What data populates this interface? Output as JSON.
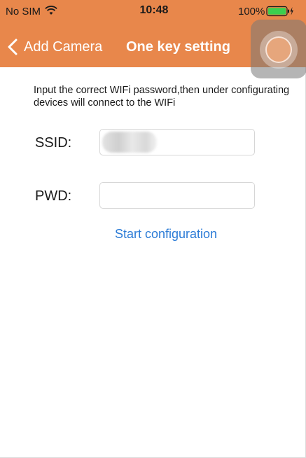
{
  "status_bar": {
    "carrier": "No SIM",
    "time": "10:48",
    "battery": "100%",
    "wifi_icon": "wifi-icon",
    "battery_icon": "battery-charging-icon"
  },
  "nav": {
    "back_label": "Add Camera",
    "title": "One key setting",
    "back_icon": "chevron-left-icon"
  },
  "colors": {
    "header_bg": "#e8874b",
    "link_blue": "#2b7bd6"
  },
  "content": {
    "instructions": "Input the correct WIFi password,then under configurating devices will connect to the WIFi",
    "ssid_label": "SSID:",
    "pwd_label": "PWD:",
    "ssid_value": "",
    "pwd_value": "",
    "start_label": "Start configuration"
  }
}
